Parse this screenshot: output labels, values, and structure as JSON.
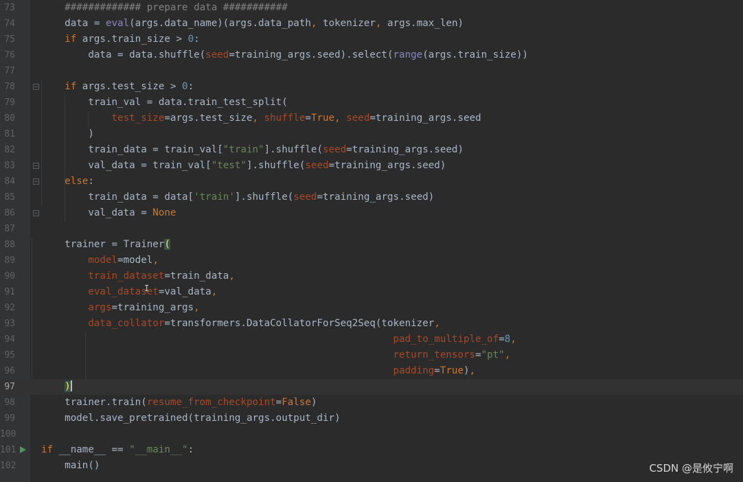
{
  "editor": {
    "lines": [
      {
        "num": "73",
        "tokens": [
          {
            "t": "    "
          },
          {
            "c": "cmt",
            "t": "############# prepare data ###########"
          }
        ]
      },
      {
        "num": "74",
        "tokens": [
          {
            "t": "    data = "
          },
          {
            "c": "fn",
            "t": "eval"
          },
          {
            "t": "(args.data_name)(args.data_path"
          },
          {
            "c": "kw",
            "t": ","
          },
          {
            "t": " tokenizer"
          },
          {
            "c": "kw",
            "t": ","
          },
          {
            "t": " args.max_len)"
          }
        ]
      },
      {
        "num": "75",
        "tokens": [
          {
            "t": "    "
          },
          {
            "c": "kw",
            "t": "if"
          },
          {
            "t": " args.train_size > "
          },
          {
            "c": "num",
            "t": "0"
          },
          {
            "t": ":"
          }
        ]
      },
      {
        "num": "76",
        "tokens": [
          {
            "t": "        data = data.shuffle("
          },
          {
            "c": "prm",
            "t": "seed"
          },
          {
            "t": "=training_args.seed).select("
          },
          {
            "c": "fn",
            "t": "range"
          },
          {
            "t": "(args.train_size))"
          }
        ]
      },
      {
        "num": "77",
        "tokens": []
      },
      {
        "num": "78",
        "fold": true,
        "tokens": [
          {
            "t": "    "
          },
          {
            "c": "kw",
            "t": "if"
          },
          {
            "t": " args.test_size > "
          },
          {
            "c": "num",
            "t": "0"
          },
          {
            "t": ":"
          }
        ]
      },
      {
        "num": "79",
        "tokens": [
          {
            "t": "        train_val = data.train_test_split("
          }
        ]
      },
      {
        "num": "80",
        "tokens": [
          {
            "t": "            "
          },
          {
            "c": "prm",
            "t": "test_size"
          },
          {
            "t": "=args.test_size"
          },
          {
            "c": "kw",
            "t": ","
          },
          {
            "t": " "
          },
          {
            "c": "prm",
            "t": "shuffle"
          },
          {
            "t": "="
          },
          {
            "c": "kw",
            "t": "True"
          },
          {
            "c": "kw",
            "t": ","
          },
          {
            "t": " "
          },
          {
            "c": "prm",
            "t": "seed"
          },
          {
            "t": "=training_args.seed"
          }
        ]
      },
      {
        "num": "81",
        "tokens": [
          {
            "t": "        )"
          }
        ]
      },
      {
        "num": "82",
        "tokens": [
          {
            "t": "        train_data = train_val["
          },
          {
            "c": "str",
            "t": "\"train\""
          },
          {
            "t": "].shuffle("
          },
          {
            "c": "prm",
            "t": "seed"
          },
          {
            "t": "=training_args.seed)"
          }
        ]
      },
      {
        "num": "83",
        "fold": true,
        "tokens": [
          {
            "t": "        val_data = train_val["
          },
          {
            "c": "str",
            "t": "\"test\""
          },
          {
            "t": "].shuffle("
          },
          {
            "c": "prm",
            "t": "seed"
          },
          {
            "t": "=training_args.seed)"
          }
        ]
      },
      {
        "num": "84",
        "fold": true,
        "tokens": [
          {
            "t": "    "
          },
          {
            "c": "kw",
            "t": "else"
          },
          {
            "t": ":"
          }
        ]
      },
      {
        "num": "85",
        "tokens": [
          {
            "t": "        train_data = data["
          },
          {
            "c": "str",
            "t": "'train'"
          },
          {
            "t": "].shuffle("
          },
          {
            "c": "prm",
            "t": "seed"
          },
          {
            "t": "=training_args.seed)"
          }
        ]
      },
      {
        "num": "86",
        "fold": true,
        "tokens": [
          {
            "t": "        val_data = "
          },
          {
            "c": "kw",
            "t": "None"
          }
        ]
      },
      {
        "num": "87",
        "tokens": []
      },
      {
        "num": "88",
        "tokens": [
          {
            "t": "    trainer = Trainer"
          },
          {
            "c": "brace-match",
            "t": "("
          }
        ]
      },
      {
        "num": "89",
        "tokens": [
          {
            "t": "        "
          },
          {
            "c": "prm",
            "t": "model"
          },
          {
            "t": "=model"
          },
          {
            "c": "kw",
            "t": ","
          }
        ]
      },
      {
        "num": "90",
        "tokens": [
          {
            "t": "        "
          },
          {
            "c": "prm",
            "t": "train_dataset"
          },
          {
            "t": "=train_data"
          },
          {
            "c": "kw",
            "t": ","
          }
        ]
      },
      {
        "num": "91",
        "tokens": [
          {
            "t": "        "
          },
          {
            "c": "prm",
            "t": "eval_dataset"
          },
          {
            "t": "=val_data"
          },
          {
            "c": "kw",
            "t": ","
          }
        ]
      },
      {
        "num": "92",
        "tokens": [
          {
            "t": "        "
          },
          {
            "c": "prm",
            "t": "args"
          },
          {
            "t": "=training_args"
          },
          {
            "c": "kw",
            "t": ","
          }
        ]
      },
      {
        "num": "93",
        "tokens": [
          {
            "t": "        "
          },
          {
            "c": "prm",
            "t": "data_collator"
          },
          {
            "t": "=transformers.DataCollatorForSeq2Seq(tokenizer"
          },
          {
            "c": "kw",
            "t": ","
          }
        ]
      },
      {
        "num": "94",
        "tokens": [
          {
            "t": "                                                            "
          },
          {
            "c": "prm",
            "t": "pad_to_multiple_of"
          },
          {
            "t": "="
          },
          {
            "c": "num",
            "t": "8"
          },
          {
            "c": "kw",
            "t": ","
          }
        ]
      },
      {
        "num": "95",
        "tokens": [
          {
            "t": "                                                            "
          },
          {
            "c": "prm",
            "t": "return_tensors"
          },
          {
            "t": "="
          },
          {
            "c": "str",
            "t": "\"pt\""
          },
          {
            "c": "kw",
            "t": ","
          }
        ]
      },
      {
        "num": "96",
        "tokens": [
          {
            "t": "                                                            "
          },
          {
            "c": "prm",
            "t": "padding"
          },
          {
            "t": "="
          },
          {
            "c": "kw",
            "t": "True"
          },
          {
            "t": ")"
          },
          {
            "c": "kw",
            "t": ","
          }
        ]
      },
      {
        "num": "97",
        "current": true,
        "tokens": [
          {
            "t": "    "
          },
          {
            "c": "brace-match",
            "t": ")"
          },
          {
            "c": "caret",
            "t": ""
          }
        ]
      },
      {
        "num": "98",
        "tokens": [
          {
            "t": "    trainer.train("
          },
          {
            "c": "prm",
            "t": "resume_from_checkpoint"
          },
          {
            "t": "="
          },
          {
            "c": "kw",
            "t": "False"
          },
          {
            "t": ")"
          }
        ]
      },
      {
        "num": "99",
        "tokens": [
          {
            "t": "    model.save_pretrained(training_args.output_dir)"
          }
        ]
      },
      {
        "num": "100",
        "tokens": []
      },
      {
        "num": "101",
        "run": true,
        "tokens": [
          {
            "c": "kw",
            "t": "if"
          },
          {
            "t": " __name__ == "
          },
          {
            "c": "str",
            "t": "\"__main__\""
          },
          {
            "t": ":"
          }
        ]
      },
      {
        "num": "102",
        "tokens": [
          {
            "t": "    main()"
          }
        ]
      }
    ]
  },
  "watermark": "CSDN @是攸宁啊"
}
